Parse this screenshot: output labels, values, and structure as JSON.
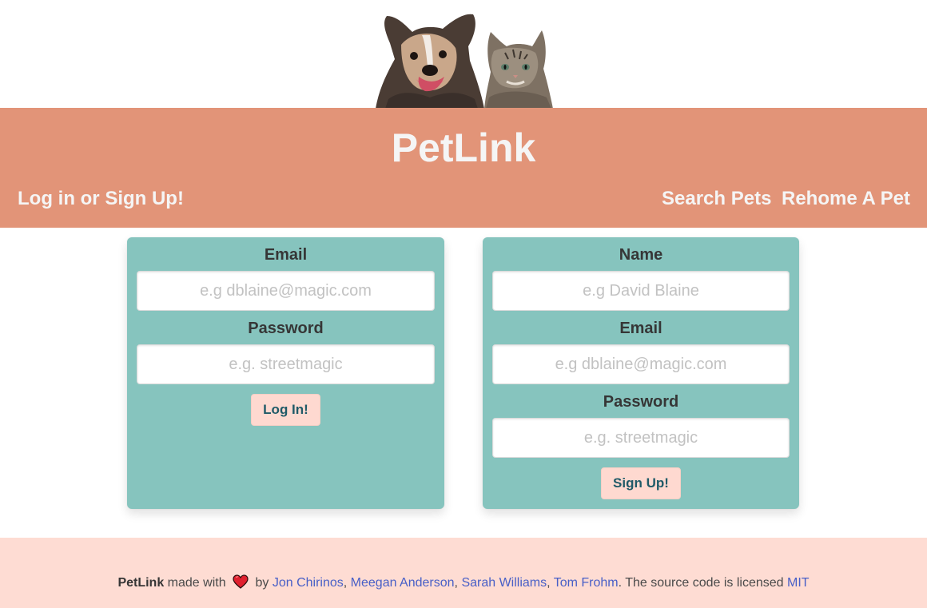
{
  "header": {
    "site_title": "PetLink",
    "hero_color": "#e29478",
    "nav": {
      "login_label": "Log in or Sign Up!",
      "search_label": "Search Pets",
      "rehome_label": "Rehome A Pet"
    }
  },
  "login_form": {
    "email_label": "Email",
    "email_placeholder": "e.g dblaine@magic.com",
    "password_label": "Password",
    "password_placeholder": "e.g. streetmagic",
    "submit_label": "Log In!"
  },
  "signup_form": {
    "name_label": "Name",
    "name_placeholder": "e.g David Blaine",
    "email_label": "Email",
    "email_placeholder": "e.g dblaine@magic.com",
    "password_label": "Password",
    "password_placeholder": "e.g. streetmagic",
    "submit_label": "Sign Up!"
  },
  "footer": {
    "brand": "PetLink",
    "made_with": " made with ",
    "by": " by ",
    "authors": [
      "Jon Chirinos",
      "Meegan Anderson",
      "Sarah Williams",
      "Tom Frohm"
    ],
    "license_text": ". The source code is licensed ",
    "license_link": "MIT",
    "heart_icon": "heart-icon"
  },
  "colors": {
    "card": "#86c4be",
    "button": "#fed9d0",
    "button_text": "#1f5a68",
    "footer_bg": "#fedcd3",
    "link": "#485fc7"
  }
}
